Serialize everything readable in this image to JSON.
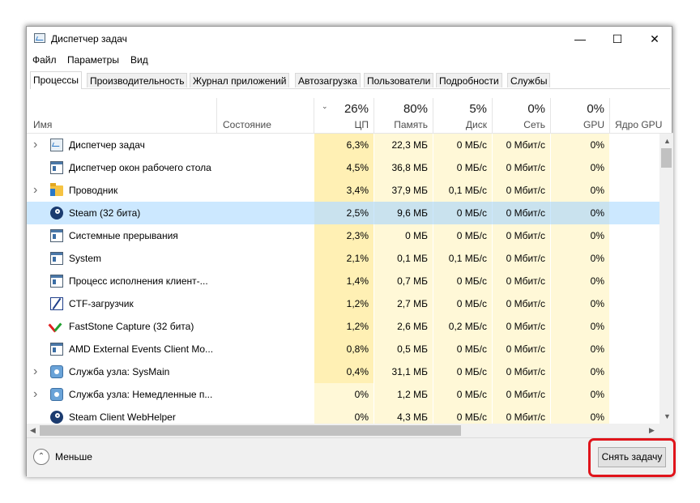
{
  "window": {
    "title": "Диспетчер задач",
    "controls": [
      "—",
      "☐",
      "✕"
    ]
  },
  "menu": [
    "Файл",
    "Параметры",
    "Вид"
  ],
  "tabs": [
    "Процессы",
    "Производительность",
    "Журнал приложений",
    "Автозагрузка",
    "Пользователи",
    "Подробности",
    "Службы"
  ],
  "active_tab": "Процессы",
  "columns": {
    "name": "Имя",
    "status": "Состояние",
    "cpu": {
      "pct": "26%",
      "label": "ЦП"
    },
    "memory": {
      "pct": "80%",
      "label": "Память"
    },
    "disk": {
      "pct": "5%",
      "label": "Диск"
    },
    "network": {
      "pct": "0%",
      "label": "Сеть"
    },
    "gpu": {
      "pct": "0%",
      "label": "GPU"
    },
    "gpu_engine": "Ядро GPU"
  },
  "processes": [
    {
      "name": "Диспетчер задач",
      "icon": "task-manager-icon",
      "expandable": true,
      "cpu": "6,3%",
      "mem": "22,3 МБ",
      "disk": "0 МБ/с",
      "net": "0 Мбит/с",
      "gpu": "0%"
    },
    {
      "name": "Диспетчер окон рабочего стола",
      "icon": "window-icon",
      "expandable": false,
      "cpu": "4,5%",
      "mem": "36,8 МБ",
      "disk": "0 МБ/с",
      "net": "0 Мбит/с",
      "gpu": "0%"
    },
    {
      "name": "Проводник",
      "icon": "folder-icon",
      "expandable": true,
      "cpu": "3,4%",
      "mem": "37,9 МБ",
      "disk": "0,1 МБ/с",
      "net": "0 Мбит/с",
      "gpu": "0%"
    },
    {
      "name": "Steam (32 бита)",
      "icon": "steam-icon",
      "expandable": false,
      "selected": true,
      "cpu": "2,5%",
      "mem": "9,6 МБ",
      "disk": "0 МБ/с",
      "net": "0 Мбит/с",
      "gpu": "0%"
    },
    {
      "name": "Системные прерывания",
      "icon": "window-icon",
      "expandable": false,
      "cpu": "2,3%",
      "mem": "0 МБ",
      "disk": "0 МБ/с",
      "net": "0 Мбит/с",
      "gpu": "0%"
    },
    {
      "name": "System",
      "icon": "window-icon",
      "expandable": false,
      "cpu": "2,1%",
      "mem": "0,1 МБ",
      "disk": "0,1 МБ/с",
      "net": "0 Мбит/с",
      "gpu": "0%"
    },
    {
      "name": "Процесс исполнения клиент-...",
      "icon": "window-icon",
      "expandable": false,
      "cpu": "1,4%",
      "mem": "0,7 МБ",
      "disk": "0 МБ/с",
      "net": "0 Мбит/с",
      "gpu": "0%"
    },
    {
      "name": "CTF-загрузчик",
      "icon": "ctf-icon",
      "expandable": false,
      "cpu": "1,2%",
      "mem": "2,7 МБ",
      "disk": "0 МБ/с",
      "net": "0 Мбит/с",
      "gpu": "0%"
    },
    {
      "name": "FastStone Capture (32 бита)",
      "icon": "faststone-icon",
      "expandable": false,
      "cpu": "1,2%",
      "mem": "2,6 МБ",
      "disk": "0,2 МБ/с",
      "net": "0 Мбит/с",
      "gpu": "0%"
    },
    {
      "name": "AMD External Events Client Mo...",
      "icon": "window-icon",
      "expandable": false,
      "cpu": "0,8%",
      "mem": "0,5 МБ",
      "disk": "0 МБ/с",
      "net": "0 Мбит/с",
      "gpu": "0%"
    },
    {
      "name": "Служба узла: SysMain",
      "icon": "gear-icon",
      "expandable": true,
      "cpu": "0,4%",
      "mem": "31,1 МБ",
      "disk": "0 МБ/с",
      "net": "0 Мбит/с",
      "gpu": "0%"
    },
    {
      "name": "Служба узла: Немедленные п...",
      "icon": "gear-icon",
      "expandable": true,
      "cpu": "0%",
      "mem": "1,2 МБ",
      "disk": "0 МБ/с",
      "net": "0 Мбит/с",
      "gpu": "0%"
    },
    {
      "name": "Steam Client WebHelper",
      "icon": "steam-icon",
      "expandable": false,
      "cpu": "0%",
      "mem": "4,3 МБ",
      "disk": "0 МБ/с",
      "net": "0 Мбит/с",
      "gpu": "0%"
    }
  ],
  "footer": {
    "less_label": "Меньше",
    "end_task_label": "Снять задачу"
  },
  "colors": {
    "heat_high": "#fff0b4",
    "heat_low": "#fff8d7",
    "selected_row": "#cce8ff",
    "highlight_border": "#e0141b"
  }
}
